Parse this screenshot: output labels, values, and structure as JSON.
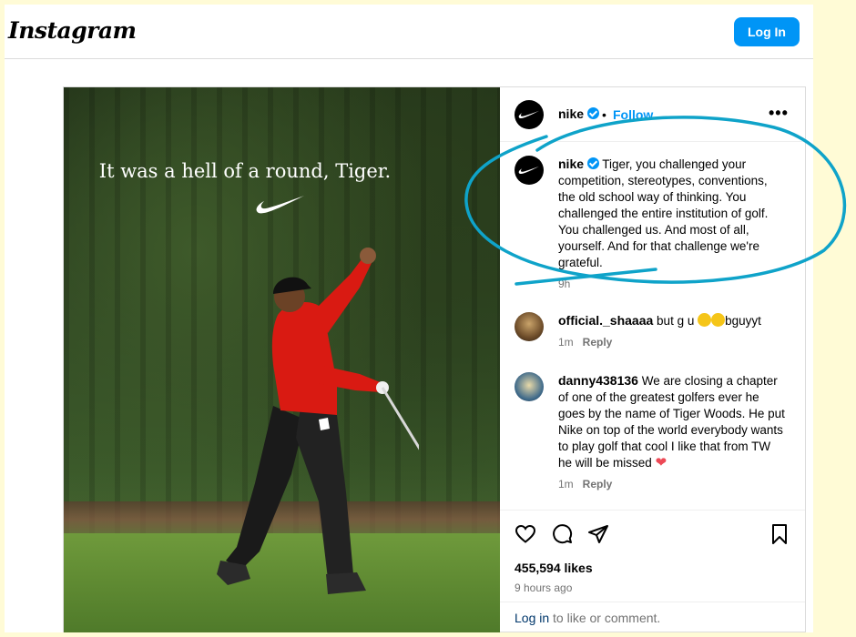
{
  "topbar": {
    "logo": "Instagram",
    "login_button": "Log In"
  },
  "post": {
    "image_caption": "It was a hell of a round, Tiger.",
    "author": {
      "username": "nike",
      "separator": "•",
      "follow_label": "Follow",
      "more_label": "•••"
    },
    "caption": {
      "username": "nike",
      "text": "Tiger, you challenged your competition, stereotypes, conventions, the old school way of thinking. You challenged the entire institution of golf. You challenged us. And most of all, yourself. And for that challenge we're grateful.",
      "time": "9h"
    },
    "comments": [
      {
        "username": "official._shaaaa",
        "text_before": "but g u",
        "text_after": "bguyyt",
        "time": "1m",
        "reply_label": "Reply"
      },
      {
        "username": "danny438136",
        "text": "We are closing a chapter of one of the greatest golfers ever he goes by the name of Tiger Woods. He put Nike on top of the world everybody wants to play golf that cool I like that from TW he will be missed",
        "heart": "❤",
        "time": "1m",
        "reply_label": "Reply"
      }
    ],
    "likes": "455,594 likes",
    "posted_time": "9 hours ago",
    "login_prompt": {
      "link": "Log in",
      "rest": " to like or comment."
    }
  },
  "colors": {
    "accent_blue": "#0095f6",
    "annotation_stroke": "#0fa3c9",
    "page_background": "#fffbd6"
  },
  "icons": [
    "heart-icon",
    "comment-icon",
    "share-icon",
    "bookmark-icon",
    "verified-badge-icon",
    "nike-swoosh-icon"
  ]
}
